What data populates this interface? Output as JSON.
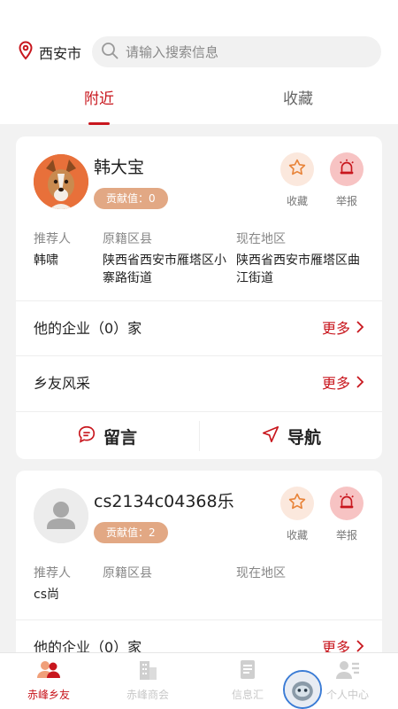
{
  "header": {
    "location": "西安市",
    "search_placeholder": "请输入搜索信息",
    "tabs": [
      {
        "label": "附近",
        "active": true
      },
      {
        "label": "收藏",
        "active": false
      }
    ]
  },
  "action_labels": {
    "favorite": "收藏",
    "report": "举报"
  },
  "info_headers": {
    "recommender": "推荐人",
    "origin": "原籍区县",
    "current": "现在地区"
  },
  "cards": [
    {
      "name": "韩大宝",
      "badge": "贡献值：0",
      "recommender": "韩啸",
      "origin": "陕西省西安市雁塔区小寨路街道",
      "current": "陕西省西安市雁塔区曲江街道",
      "company_row": "他的企业（0）家",
      "hometown_row": "乡友风采",
      "more": "更多",
      "message_btn": "留言",
      "navigate_btn": "导航"
    },
    {
      "name": "cs2134c04368乐",
      "badge": "贡献值：2",
      "recommender": "cs尚",
      "origin": "",
      "current": "",
      "company_row": "他的企业（0）家",
      "more": "更多"
    }
  ],
  "tabbar": [
    {
      "label": "赤峰乡友",
      "icon": "people-icon",
      "active": true
    },
    {
      "label": "赤峰商会",
      "icon": "building-icon",
      "active": false
    },
    {
      "label": "信息汇",
      "icon": "document-icon",
      "active": false
    },
    {
      "label": "个人中心",
      "icon": "profile-icon",
      "active": false
    }
  ],
  "colors": {
    "accent": "#c8161d",
    "badge": "#e2a884",
    "background": "#f2f2f2"
  }
}
